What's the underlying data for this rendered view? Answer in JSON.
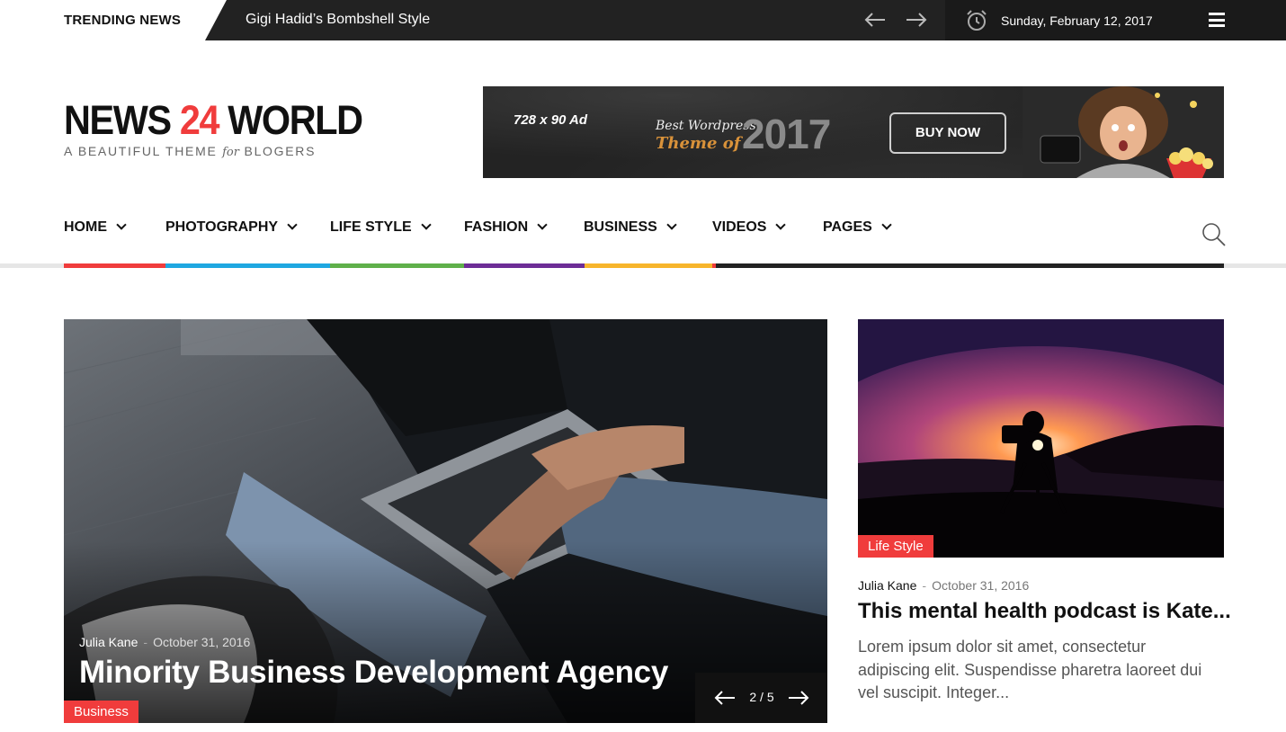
{
  "topbar": {
    "trending_label": "TRENDING NEWS",
    "headline": "Gigi Hadid’s Bombshell Style",
    "date": "Sunday, February 12, 2017",
    "icons": [
      "arrow-left-icon",
      "arrow-right-icon",
      "alarm-clock-icon",
      "hamburger-menu-icon"
    ]
  },
  "logo": {
    "part1": "NEWS ",
    "accent": "24",
    "part2": " WORLD",
    "tag_pre": "A BEAUTIFUL THEME ",
    "tag_em": "for",
    "tag_post": " BLOGERS"
  },
  "ad": {
    "size": "728 x 90 Ad",
    "best": "Best Wordpress",
    "theme": "Theme of",
    "year": "2017",
    "button": "BUY NOW"
  },
  "nav": {
    "items": [
      {
        "label": "HOME",
        "color": "#f03c3c"
      },
      {
        "label": "PHOTOGRAPHY",
        "color": "#1ea7e1"
      },
      {
        "label": "LIFE STYLE",
        "color": "#5fb04a"
      },
      {
        "label": "FASHION",
        "color": "#6d2d96"
      },
      {
        "label": "BUSINESS",
        "color": "#f7b52c"
      },
      {
        "label": "VIDEOS",
        "color": "#222222"
      },
      {
        "label": "PAGES",
        "color": "#222222"
      }
    ],
    "search_icon": "search-icon"
  },
  "featured": {
    "author": "Julia Kane",
    "date": "October 31, 2016",
    "title": "Minority Business Development Agency",
    "category": "Business",
    "pagination": "2 / 5"
  },
  "side": {
    "category": "Life Style",
    "author": "Julia Kane",
    "date": "October 31, 2016",
    "title": "This mental health podcast is Kate...",
    "excerpt": "Lorem ipsum dolor sit amet, consectetur adipiscing elit. Suspendisse pharetra laoreet dui vel suscipit. Integer..."
  },
  "colors": {
    "accent_red": "#f03c3c",
    "topbar_bg": "#222222"
  }
}
